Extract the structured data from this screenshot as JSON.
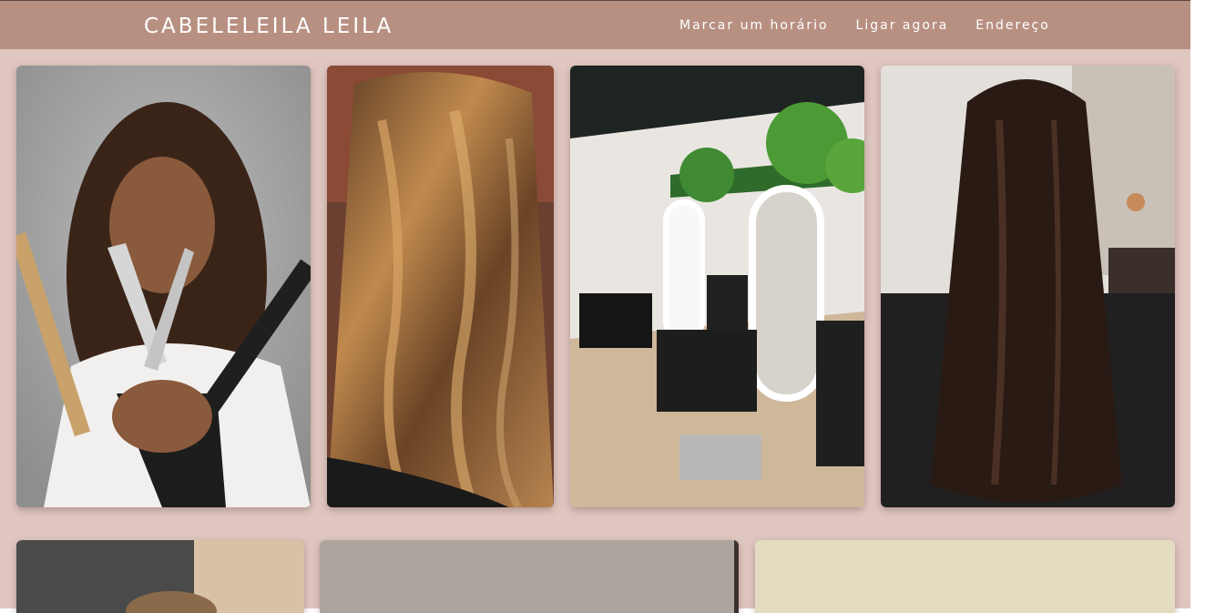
{
  "header": {
    "brand": "CABELELEILA LEILA",
    "nav": [
      {
        "label": "Marcar um horário"
      },
      {
        "label": "Ligar agora"
      },
      {
        "label": "Endereço"
      }
    ]
  },
  "colors": {
    "background": "#dfc6c0",
    "header": "#b89082",
    "text": "#ffffff"
  },
  "gallery": {
    "row1": [
      {
        "subject": "stylist-with-scissors-and-combs"
      },
      {
        "subject": "balayage-wavy-hair"
      },
      {
        "subject": "salon-interior-chairs-mirrors"
      },
      {
        "subject": "long-straight-dark-hair"
      }
    ],
    "row2": [
      {
        "subject": "photo-partial"
      },
      {
        "subject": "photo-partial"
      },
      {
        "subject": "photo-partial"
      }
    ]
  }
}
